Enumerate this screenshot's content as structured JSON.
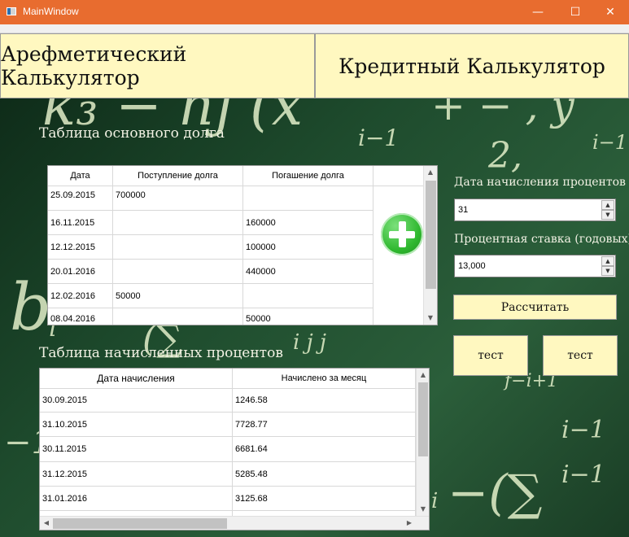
{
  "window": {
    "title": "MainWindow",
    "controls": {
      "minimize": "—",
      "maximize": "☐",
      "close": "✕"
    }
  },
  "tabs": {
    "arith": "Арефметический Калькулятор",
    "credit": "Кредитный Калькулятор"
  },
  "background_glyphs": [
    "k₃ − hj (x",
    "i−1",
    "+ − , y",
    "i−1",
    "2,",
    "b",
    "i",
    "(∑",
    "i  j  j",
    "i−1",
    "f−i+1",
    "−1",
    "i−1",
    "−(∑",
    "i"
  ],
  "debt_table": {
    "title": "Таблица основного долга",
    "headers": [
      "Дата",
      "Поступление долга",
      "Погашение долга"
    ],
    "rows": [
      [
        "25.09.2015",
        "700000",
        ""
      ],
      [
        "16.11.2015",
        "",
        "160000"
      ],
      [
        "12.12.2015",
        "",
        "100000"
      ],
      [
        "20.01.2016",
        "",
        "440000"
      ],
      [
        "12.02.2016",
        "50000",
        ""
      ],
      [
        "08.04.2016",
        "",
        "50000"
      ]
    ]
  },
  "interest_table": {
    "title": "Таблица начисленных процентов",
    "headers": [
      "Дата начисления",
      "Начислено за месяц"
    ],
    "rows": [
      [
        "30.09.2015",
        "1246.58"
      ],
      [
        "31.10.2015",
        "7728.77"
      ],
      [
        "30.11.2015",
        "6681.64"
      ],
      [
        "31.12.2015",
        "5285.48"
      ],
      [
        "31.01.2016",
        "3125.68"
      ]
    ]
  },
  "controls": {
    "day_label": "Дата начисления процентов",
    "day_value": "31",
    "rate_label": "Процентная ставка (годовых)",
    "rate_value": "13,000",
    "calc_button": "Рассчитать",
    "test1": "тест",
    "test2": "тест"
  },
  "colors": {
    "titlebar": "#e86c2f",
    "button_fill": "#fff8c0",
    "background": "#1f4a2c",
    "add_icon": "#2fb82f"
  }
}
